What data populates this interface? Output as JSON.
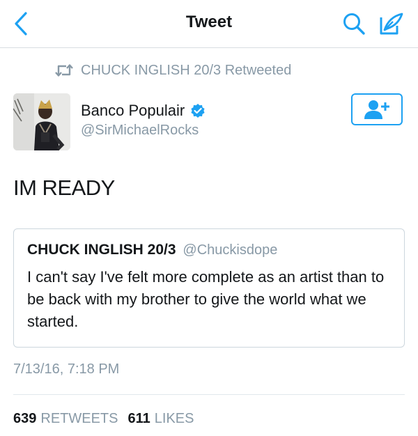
{
  "nav": {
    "title": "Tweet",
    "back_icon": "chevron-left-icon",
    "search_icon": "search-icon",
    "compose_icon": "compose-icon",
    "accent": "#1da1f2"
  },
  "retweet_context": {
    "icon": "retweet-icon",
    "text": "CHUCK INGLISH 20/3 Retweeted"
  },
  "tweet": {
    "author_name": "Banco Populair",
    "author_handle": "@SirMichaelRocks",
    "verified": true,
    "follow_icon": "add-user-icon",
    "text": "IM READY",
    "timestamp": "7/13/16, 7:18 PM"
  },
  "quoted_tweet": {
    "author_name": "CHUCK INGLISH 20/3",
    "author_handle": "@Chuckisdope",
    "text": "I can't say I've felt more complete as an artist than to be back with my brother to give the world what we started."
  },
  "stats": {
    "retweets_count": "639",
    "retweets_label": "RETWEETS",
    "likes_count": "611",
    "likes_label": "LIKES"
  }
}
